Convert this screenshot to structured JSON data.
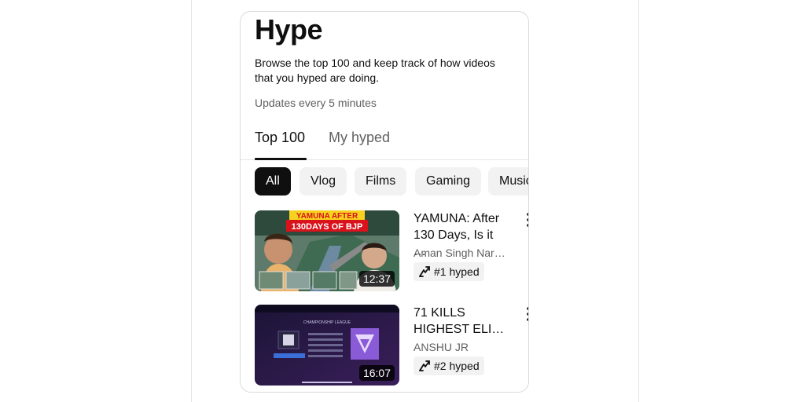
{
  "page": {
    "title": "Hype",
    "description": "Browse the top 100 and keep track of how videos that you hyped are doing.",
    "updates": "Updates every 5 minutes"
  },
  "tabs": [
    {
      "label": "Top 100",
      "selected": true
    },
    {
      "label": "My hyped",
      "selected": false
    }
  ],
  "chips": [
    {
      "label": "All",
      "selected": true
    },
    {
      "label": "Vlog",
      "selected": false
    },
    {
      "label": "Films",
      "selected": false
    },
    {
      "label": "Gaming",
      "selected": false
    },
    {
      "label": "Music",
      "selected": false
    }
  ],
  "videos": [
    {
      "title": "YAMUNA: After 130 Days, Is it …",
      "channel": "Aman Singh Nar…",
      "hype": "#1 hyped",
      "duration": "12:37",
      "thumb_text": [
        "YAMUNA AFTER",
        "130DAYS OF BJP"
      ]
    },
    {
      "title": "71 KILLS HIGHEST ELI…",
      "channel": "ANSHU JR",
      "hype": "#2 hyped",
      "duration": "16:07",
      "thumb_text": [
        "CHAMPIONSHIP LEAGUE"
      ]
    }
  ],
  "icons": {
    "more": "more-vert-icon",
    "hype": "hype-icon"
  },
  "colors": {
    "text_primary": "#0f0f0f",
    "text_secondary": "#606060",
    "chip_bg": "#f2f2f2",
    "chip_active_bg": "#0f0f0f"
  }
}
